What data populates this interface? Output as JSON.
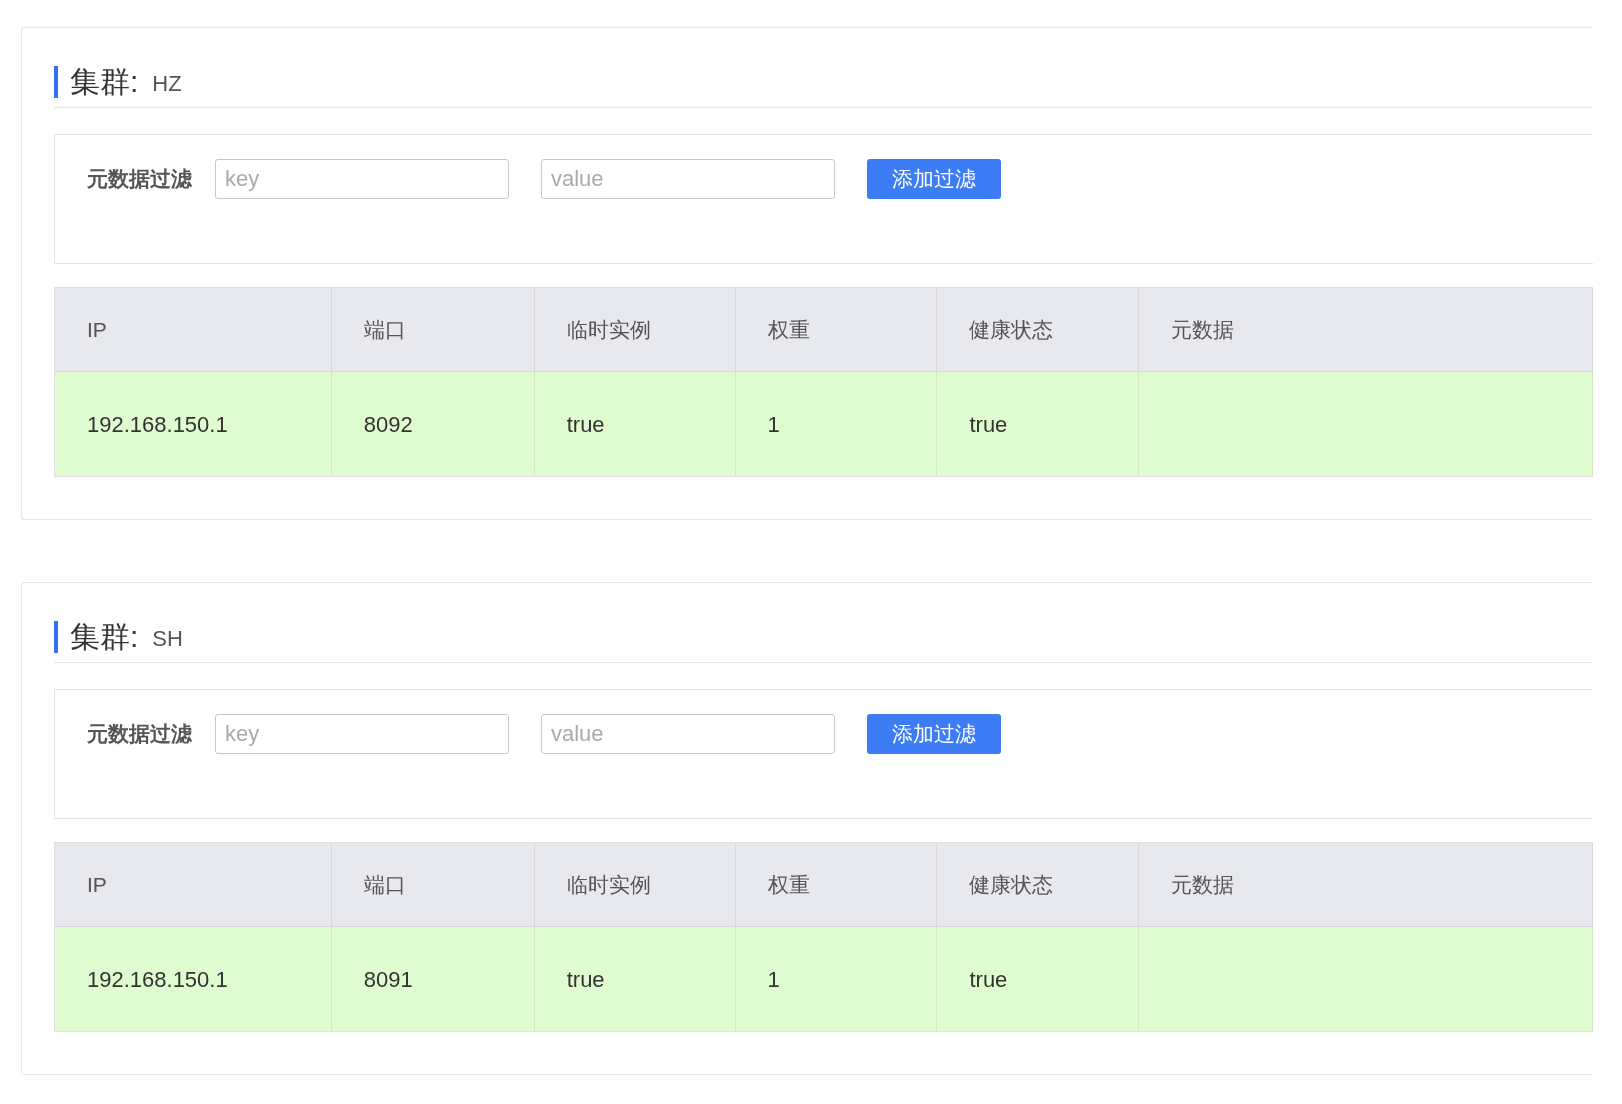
{
  "clusters": [
    {
      "label": "集群:",
      "name": "HZ",
      "filter": {
        "label": "元数据过滤",
        "key_placeholder": "key",
        "value_placeholder": "value",
        "button": "添加过滤"
      },
      "table": {
        "columns": [
          "IP",
          "端口",
          "临时实例",
          "权重",
          "健康状态",
          "元数据"
        ],
        "rows": [
          [
            "192.168.150.1",
            "8092",
            "true",
            "1",
            "true",
            ""
          ]
        ]
      }
    },
    {
      "label": "集群:",
      "name": "SH",
      "filter": {
        "label": "元数据过滤",
        "key_placeholder": "key",
        "value_placeholder": "value",
        "button": "添加过滤"
      },
      "table": {
        "columns": [
          "IP",
          "端口",
          "临时实例",
          "权重",
          "健康状态",
          "元数据"
        ],
        "rows": [
          [
            "192.168.150.1",
            "8091",
            "true",
            "1",
            "true",
            ""
          ]
        ]
      }
    }
  ]
}
